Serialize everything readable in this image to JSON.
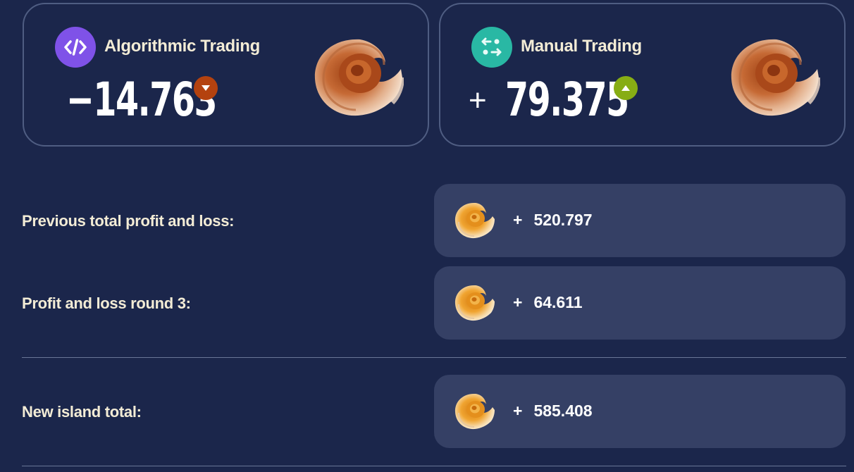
{
  "cards": {
    "algorithmic": {
      "title": "Algorithmic Trading",
      "sign": "−",
      "value": "14.763",
      "trend": "down",
      "icon": "code-icon",
      "icon_color": "#7f52e8",
      "trend_color": "#b4420f"
    },
    "manual": {
      "title": "Manual Trading",
      "sign": "+",
      "value": "79.375",
      "trend": "up",
      "icon": "swap-arrows-icon",
      "icon_color": "#29b8a4",
      "trend_color": "#87ad14"
    }
  },
  "summary": {
    "previous": {
      "label": "Previous total profit and loss:",
      "sign": "+",
      "value": "520.797"
    },
    "round": {
      "label": "Profit and loss round 3:",
      "sign": "+",
      "value": "64.611"
    },
    "total": {
      "label": "New island total:",
      "sign": "+",
      "value": "585.408"
    }
  },
  "colors": {
    "background": "#1b264b",
    "card_border": "#4f5d82",
    "value_box": "#354065",
    "label_text": "#f3ecd6"
  },
  "icons": {
    "currency": "seashell-icon"
  }
}
